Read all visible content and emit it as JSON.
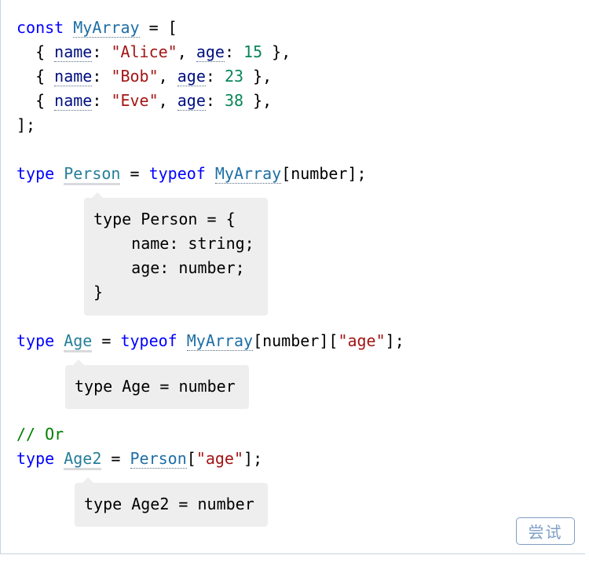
{
  "code": {
    "l1": {
      "kw": "const",
      "name": "MyArray",
      "rest": " = ["
    },
    "l2": {
      "indent": "  { ",
      "k1": "name",
      "sep1": ": ",
      "v1": "\"Alice\"",
      "sep2": ", ",
      "k2": "age",
      "sep3": ": ",
      "v2": "15",
      "end": " },"
    },
    "l3": {
      "indent": "  { ",
      "k1": "name",
      "sep1": ": ",
      "v1": "\"Bob\"",
      "sep2": ", ",
      "k2": "age",
      "sep3": ": ",
      "v2": "23",
      "end": " },"
    },
    "l4": {
      "indent": "  { ",
      "k1": "name",
      "sep1": ": ",
      "v1": "\"Eve\"",
      "sep2": ", ",
      "k2": "age",
      "sep3": ": ",
      "v2": "38",
      "end": " },"
    },
    "l5": {
      "text": "];"
    },
    "l6": {
      "kw": "type",
      "name": "Person",
      "eq": " = ",
      "kw2": "typeof",
      "ref": "MyArray",
      "tail": "[number];"
    },
    "l7": {
      "kw": "type",
      "name": "Age",
      "eq": " = ",
      "kw2": "typeof",
      "ref": "MyArray",
      "tail1": "[number][",
      "str": "\"age\"",
      "tail2": "];"
    },
    "l8": {
      "comment": "// Or"
    },
    "l9": {
      "kw": "type",
      "name": "Age2",
      "eq": " = ",
      "ref": "Person",
      "tail1": "[",
      "str": "\"age\"",
      "tail2": "];"
    }
  },
  "tooltips": {
    "person": [
      "type Person = {",
      "    name: string;",
      "    age: number;",
      "}"
    ],
    "age": "type Age = number",
    "age2": "type Age2 = number"
  },
  "try_button": {
    "label": "尝试"
  }
}
